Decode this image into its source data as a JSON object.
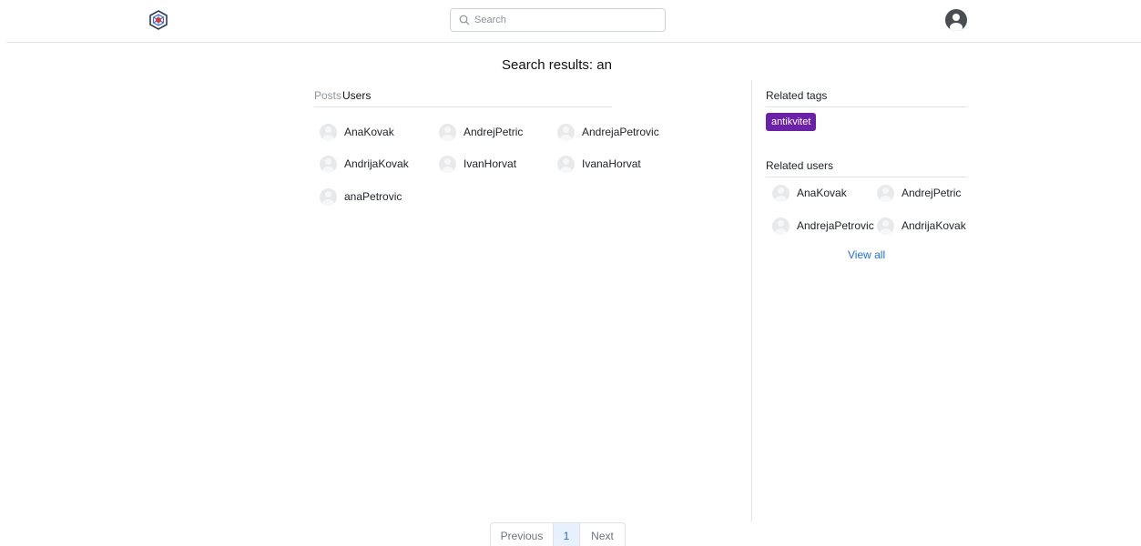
{
  "header": {
    "search": {
      "placeholder": "Search",
      "value": ""
    }
  },
  "page_title": "Search results: an",
  "tabs": [
    {
      "label": "Posts",
      "active": false
    },
    {
      "label": "Users",
      "active": true
    }
  ],
  "results": {
    "users": [
      "AnaKovak",
      "AndrejPetric",
      "AndrejaPetrovic",
      "AndrijaKovak",
      "IvanHorvat",
      "IvanaHorvat",
      "anaPetrovic"
    ]
  },
  "sidebar": {
    "related_tags_heading": "Related tags",
    "tags": [
      "antikvitet"
    ],
    "tag_color": "#6b21a8",
    "related_users_heading": "Related users",
    "related_users": [
      "AnaKovak",
      "AndrejPetric",
      "AndrejaPetrovic",
      "AndrijaKovak"
    ],
    "view_all_label": "View all"
  },
  "pagination": {
    "previous_label": "Previous",
    "current_page": "1",
    "next_label": "Next"
  },
  "colors": {
    "link": "#1d6fdc",
    "active_page_bg": "#e7f1ff"
  },
  "icons": {
    "logo": "hexagon-logo-icon",
    "search": "search-icon",
    "profile": "user-profile-icon",
    "avatar": "avatar-placeholder-icon"
  }
}
